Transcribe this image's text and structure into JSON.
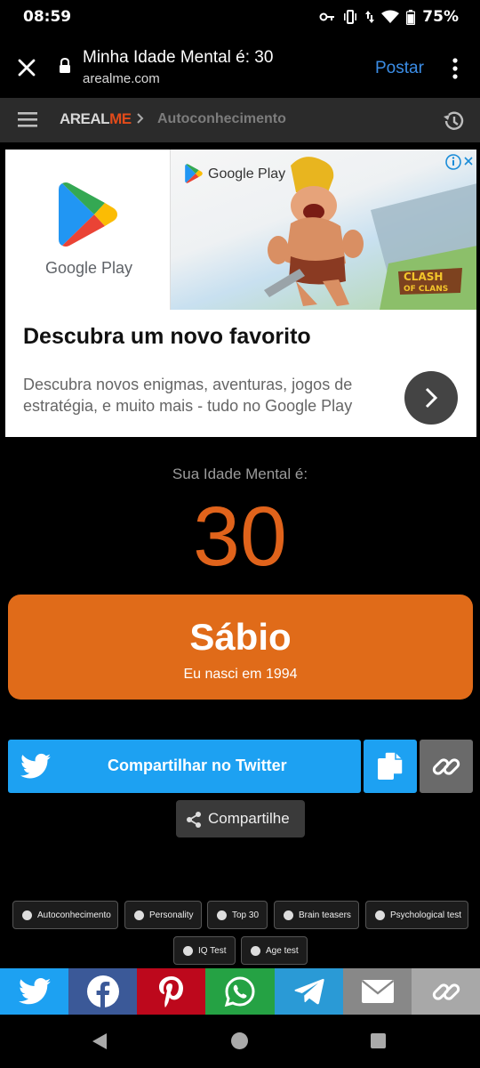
{
  "status": {
    "time": "08:59",
    "battery": "75%"
  },
  "browser": {
    "title": "Minha Idade Mental é: 30",
    "domain": "arealme.com",
    "post_label": "Postar"
  },
  "site_nav": {
    "logo_part1": "AREAL",
    "logo_part2": "ME",
    "breadcrumb": "Autoconhecimento"
  },
  "ad": {
    "brand": "Google Play",
    "headline": "Descubra um novo favorito",
    "body": "Descubra novos enigmas, aventuras, jogos de estratégia, e muito mais - tudo no Google Play",
    "game_logo_line1": "CLASH",
    "game_logo_line2": "OF CLANS"
  },
  "result": {
    "label": "Sua Idade Mental é:",
    "age": "30",
    "title": "Sábio",
    "subtitle": "Eu nasci em 1994"
  },
  "share": {
    "twitter_label": "Compartilhar no Twitter",
    "generic_label": "Compartilhe"
  },
  "tags": [
    "Autoconhecimento",
    "Personality",
    "Top 30",
    "Brain teasers",
    "Psychological test",
    "IQ Test",
    "Age test"
  ],
  "colors": {
    "accent_orange": "#e06b19",
    "twitter_blue": "#1da1f2",
    "facebook_blue": "#3b5998",
    "pinterest_red": "#bd081c",
    "whatsapp_green": "#25a244",
    "telegram_blue": "#2a9ad6",
    "email_gray": "#888888",
    "link_gray": "#a8a8a8"
  },
  "social_icons": [
    "twitter-icon",
    "facebook-icon",
    "pinterest-icon",
    "whatsapp-icon",
    "telegram-icon",
    "email-icon",
    "link-icon"
  ]
}
